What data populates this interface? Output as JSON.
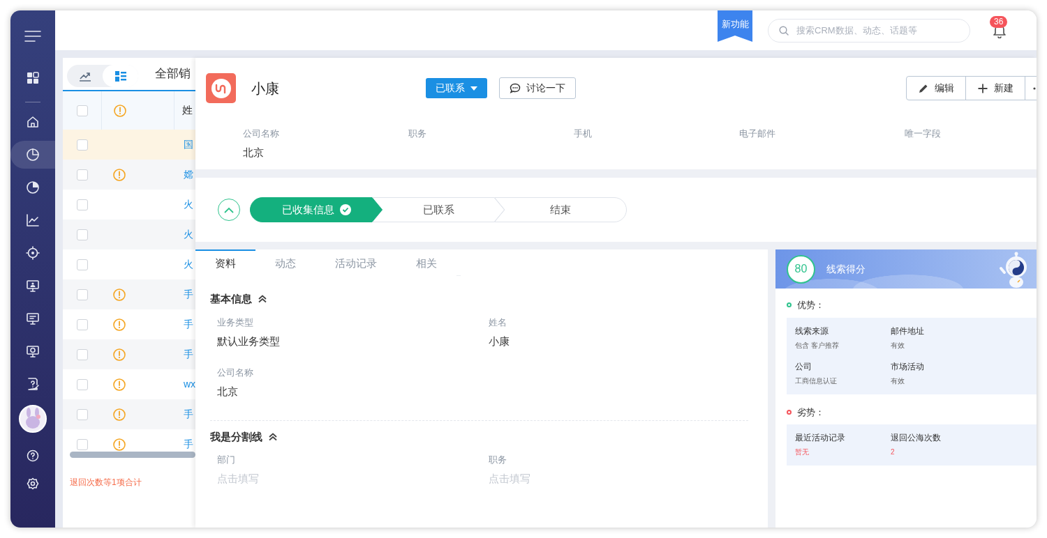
{
  "sidebar": {
    "items": [
      {
        "selected": false
      },
      {
        "selected": false
      },
      {
        "selected": true
      },
      {
        "selected": false
      },
      {
        "selected": false
      },
      {
        "selected": false
      },
      {
        "selected": false
      },
      {
        "selected": false
      },
      {
        "selected": false
      },
      {
        "selected": false
      }
    ]
  },
  "topbar": {
    "ribbon": "新功能",
    "search": {
      "placeholder": "搜索CRM数据、动态、话题等"
    },
    "notifications": "36"
  },
  "list": {
    "view_toggle": [
      {
        "selected": false
      },
      {
        "selected": true
      }
    ],
    "title": "全部销",
    "header": {
      "checked": false,
      "column_3": "姓"
    },
    "rows": [
      {
        "selected": true,
        "checked": false,
        "warning": false,
        "name": "国"
      },
      {
        "selected": false,
        "checked": false,
        "warning": true,
        "name": "嫦"
      },
      {
        "selected": false,
        "checked": false,
        "warning": false,
        "name": "火"
      },
      {
        "selected": false,
        "checked": false,
        "warning": false,
        "name": "火"
      },
      {
        "selected": false,
        "checked": false,
        "warning": false,
        "name": "火"
      },
      {
        "selected": false,
        "checked": false,
        "warning": true,
        "name": "手"
      },
      {
        "selected": false,
        "checked": false,
        "warning": true,
        "name": "手"
      },
      {
        "selected": false,
        "checked": false,
        "warning": true,
        "name": "手"
      },
      {
        "selected": false,
        "checked": false,
        "warning": true,
        "name": "wx"
      },
      {
        "selected": false,
        "checked": false,
        "warning": true,
        "name": "手"
      },
      {
        "selected": false,
        "checked": false,
        "warning": true,
        "name": "手"
      }
    ],
    "footer": "退回次数等1项合计"
  },
  "detail": {
    "name": "小康",
    "status_button": "已联系",
    "discuss_button": "讨论一下",
    "actions": [
      "编辑",
      "新建"
    ],
    "summary_fields": [
      {
        "label": "公司名称",
        "value": "北京"
      },
      {
        "label": "职务"
      },
      {
        "label": "手机"
      },
      {
        "label": "电子邮件"
      },
      {
        "label": "唯一字段"
      }
    ],
    "stages": [
      {
        "label": "已收集信息",
        "done": true
      },
      {
        "label": "已联系",
        "done": false
      },
      {
        "label": "结束",
        "done": false
      }
    ],
    "tabs": [
      {
        "label": "资料",
        "selected": true
      },
      {
        "label": "动态",
        "selected": false
      },
      {
        "label": "活动记录",
        "selected": false
      },
      {
        "label": "相关",
        "selected": false
      }
    ],
    "sections": [
      {
        "title": "基本信息",
        "expanded": true,
        "fields": [
          {
            "label": "业务类型",
            "value": "默认业务类型"
          },
          {
            "label": "姓名",
            "value": "小康"
          },
          {
            "label": "公司名称",
            "value": "北京"
          }
        ]
      },
      {
        "title": "我是分割线",
        "expanded": true,
        "fields": [
          {
            "label": "部门",
            "placeholder": "点击填写"
          },
          {
            "label": "职务",
            "placeholder": "点击填写"
          }
        ]
      }
    ],
    "score": {
      "value": "80",
      "title": "线索得分",
      "groups": [
        {
          "title": "优势：",
          "color": "#2fc38d",
          "kind": "strength",
          "items": [
            {
              "label": "线索来源",
              "value": "包含 客户推荐"
            },
            {
              "label": "邮件地址",
              "value": "有效"
            },
            {
              "label": "公司",
              "value": "工商信息认证"
            },
            {
              "label": "市场活动",
              "value": "有效"
            }
          ]
        },
        {
          "title": "劣势：",
          "color": "#f5545b",
          "kind": "weakness",
          "items": [
            {
              "label": "最近活动记录",
              "value": "暂无"
            },
            {
              "label": "退回公海次数",
              "value": "2"
            }
          ]
        }
      ]
    }
  }
}
